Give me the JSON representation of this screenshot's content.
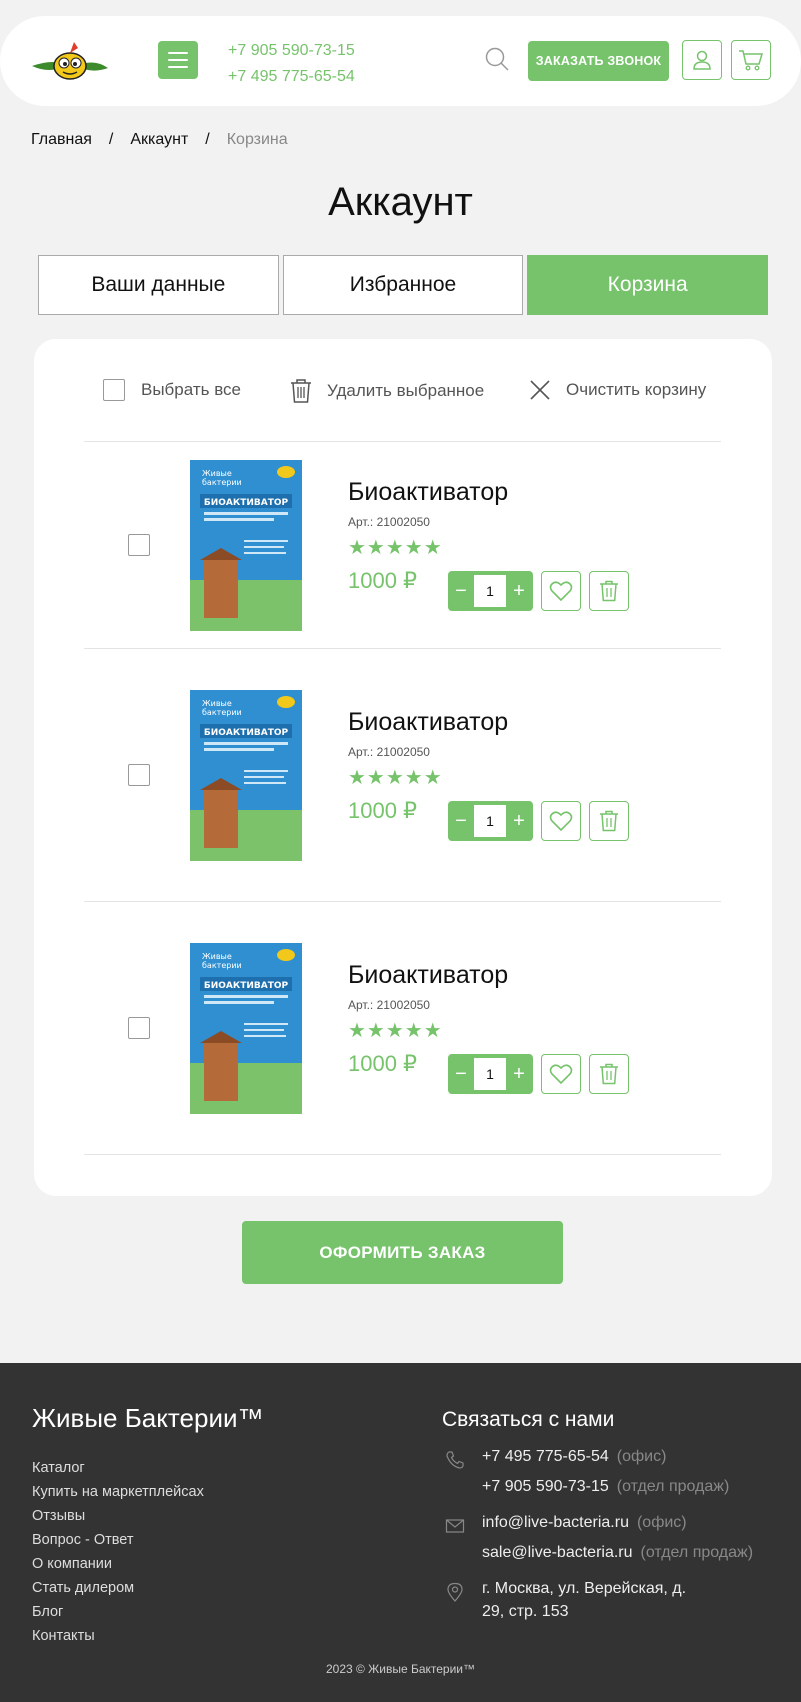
{
  "header": {
    "phones": [
      "+7 905 590-73-15",
      "+7 495 775-65-54"
    ],
    "call_button": "ЗАКАЗАТЬ ЗВОНОК",
    "accent_color": "#76c36b"
  },
  "breadcrumb": {
    "items": [
      "Главная",
      "Аккаунт",
      "Корзина"
    ],
    "separator": "/"
  },
  "page_title": "Аккаунт",
  "tabs": [
    {
      "label": "Ваши данные",
      "active": false
    },
    {
      "label": "Избранное",
      "active": false
    },
    {
      "label": "Корзина",
      "active": true
    }
  ],
  "cart": {
    "actions": {
      "select_all": "Выбрать все",
      "delete_selected": "Удалить выбранное",
      "clear_cart": "Очистить корзину"
    },
    "items": [
      {
        "name": "Биоактиватор",
        "sku": "Арт.: 21002050",
        "stars": "★★★★★",
        "price": "1000 ₽",
        "qty": "1"
      },
      {
        "name": "Биоактиватор",
        "sku": "Арт.: 21002050",
        "stars": "★★★★★",
        "price": "1000 ₽",
        "qty": "1"
      },
      {
        "name": "Биоактиватор",
        "sku": "Арт.: 21002050",
        "stars": "★★★★★",
        "price": "1000 ₽",
        "qty": "1"
      }
    ],
    "qty_minus": "−",
    "qty_plus": "+",
    "checkout": "ОФОРМИТЬ ЗАКАЗ"
  },
  "footer": {
    "brand": "Живые Бактерии™",
    "links": [
      "Каталог",
      "Купить на маркетплейсах",
      "Отзывы",
      "Вопрос - Ответ",
      "О компании",
      "Стать дилером",
      "Блог",
      "Контакты"
    ],
    "contact_title": "Связаться с нами",
    "phone1": "+7 495 775-65-54",
    "phone1_note": "(офис)",
    "phone2": "+7 905 590-73-15",
    "phone2_note": "(отдел продаж)",
    "email1": "info@live-bacteria.ru",
    "email1_note": "(офис)",
    "email2": "sale@live-bacteria.ru",
    "email2_note": "(отдел продаж)",
    "address_line1": "г. Москва, ул. Верейская, д.",
    "address_line2": "29, стр. 153",
    "copyright": "2023 © Живые Бактерии™"
  }
}
